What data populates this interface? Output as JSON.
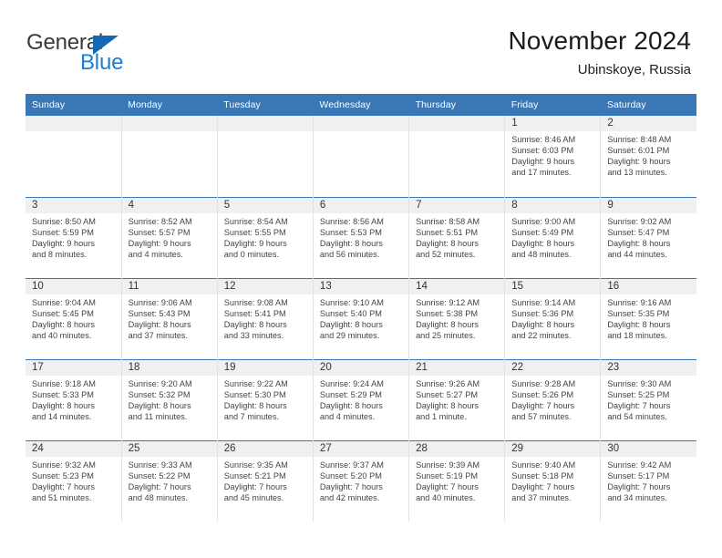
{
  "brand": {
    "name_part1": "General",
    "name_part2": "Blue"
  },
  "header": {
    "title": "November 2024",
    "location": "Ubinskoye, Russia"
  },
  "colors": {
    "header_blue": "#3a78b5",
    "logo_blue": "#1b7fd4",
    "daynum_band": "#f0f0f0",
    "cell_border": "#e2e2e2"
  },
  "weekday_headers": [
    "Sunday",
    "Monday",
    "Tuesday",
    "Wednesday",
    "Thursday",
    "Friday",
    "Saturday"
  ],
  "weeks": [
    [
      {
        "day": "",
        "info": ""
      },
      {
        "day": "",
        "info": ""
      },
      {
        "day": "",
        "info": ""
      },
      {
        "day": "",
        "info": ""
      },
      {
        "day": "",
        "info": ""
      },
      {
        "day": "1",
        "info": "Sunrise: 8:46 AM\nSunset: 6:03 PM\nDaylight: 9 hours\nand 17 minutes."
      },
      {
        "day": "2",
        "info": "Sunrise: 8:48 AM\nSunset: 6:01 PM\nDaylight: 9 hours\nand 13 minutes."
      }
    ],
    [
      {
        "day": "3",
        "info": "Sunrise: 8:50 AM\nSunset: 5:59 PM\nDaylight: 9 hours\nand 8 minutes."
      },
      {
        "day": "4",
        "info": "Sunrise: 8:52 AM\nSunset: 5:57 PM\nDaylight: 9 hours\nand 4 minutes."
      },
      {
        "day": "5",
        "info": "Sunrise: 8:54 AM\nSunset: 5:55 PM\nDaylight: 9 hours\nand 0 minutes."
      },
      {
        "day": "6",
        "info": "Sunrise: 8:56 AM\nSunset: 5:53 PM\nDaylight: 8 hours\nand 56 minutes."
      },
      {
        "day": "7",
        "info": "Sunrise: 8:58 AM\nSunset: 5:51 PM\nDaylight: 8 hours\nand 52 minutes."
      },
      {
        "day": "8",
        "info": "Sunrise: 9:00 AM\nSunset: 5:49 PM\nDaylight: 8 hours\nand 48 minutes."
      },
      {
        "day": "9",
        "info": "Sunrise: 9:02 AM\nSunset: 5:47 PM\nDaylight: 8 hours\nand 44 minutes."
      }
    ],
    [
      {
        "day": "10",
        "info": "Sunrise: 9:04 AM\nSunset: 5:45 PM\nDaylight: 8 hours\nand 40 minutes."
      },
      {
        "day": "11",
        "info": "Sunrise: 9:06 AM\nSunset: 5:43 PM\nDaylight: 8 hours\nand 37 minutes."
      },
      {
        "day": "12",
        "info": "Sunrise: 9:08 AM\nSunset: 5:41 PM\nDaylight: 8 hours\nand 33 minutes."
      },
      {
        "day": "13",
        "info": "Sunrise: 9:10 AM\nSunset: 5:40 PM\nDaylight: 8 hours\nand 29 minutes."
      },
      {
        "day": "14",
        "info": "Sunrise: 9:12 AM\nSunset: 5:38 PM\nDaylight: 8 hours\nand 25 minutes."
      },
      {
        "day": "15",
        "info": "Sunrise: 9:14 AM\nSunset: 5:36 PM\nDaylight: 8 hours\nand 22 minutes."
      },
      {
        "day": "16",
        "info": "Sunrise: 9:16 AM\nSunset: 5:35 PM\nDaylight: 8 hours\nand 18 minutes."
      }
    ],
    [
      {
        "day": "17",
        "info": "Sunrise: 9:18 AM\nSunset: 5:33 PM\nDaylight: 8 hours\nand 14 minutes."
      },
      {
        "day": "18",
        "info": "Sunrise: 9:20 AM\nSunset: 5:32 PM\nDaylight: 8 hours\nand 11 minutes."
      },
      {
        "day": "19",
        "info": "Sunrise: 9:22 AM\nSunset: 5:30 PM\nDaylight: 8 hours\nand 7 minutes."
      },
      {
        "day": "20",
        "info": "Sunrise: 9:24 AM\nSunset: 5:29 PM\nDaylight: 8 hours\nand 4 minutes."
      },
      {
        "day": "21",
        "info": "Sunrise: 9:26 AM\nSunset: 5:27 PM\nDaylight: 8 hours\nand 1 minute."
      },
      {
        "day": "22",
        "info": "Sunrise: 9:28 AM\nSunset: 5:26 PM\nDaylight: 7 hours\nand 57 minutes."
      },
      {
        "day": "23",
        "info": "Sunrise: 9:30 AM\nSunset: 5:25 PM\nDaylight: 7 hours\nand 54 minutes."
      }
    ],
    [
      {
        "day": "24",
        "info": "Sunrise: 9:32 AM\nSunset: 5:23 PM\nDaylight: 7 hours\nand 51 minutes."
      },
      {
        "day": "25",
        "info": "Sunrise: 9:33 AM\nSunset: 5:22 PM\nDaylight: 7 hours\nand 48 minutes."
      },
      {
        "day": "26",
        "info": "Sunrise: 9:35 AM\nSunset: 5:21 PM\nDaylight: 7 hours\nand 45 minutes."
      },
      {
        "day": "27",
        "info": "Sunrise: 9:37 AM\nSunset: 5:20 PM\nDaylight: 7 hours\nand 42 minutes."
      },
      {
        "day": "28",
        "info": "Sunrise: 9:39 AM\nSunset: 5:19 PM\nDaylight: 7 hours\nand 40 minutes."
      },
      {
        "day": "29",
        "info": "Sunrise: 9:40 AM\nSunset: 5:18 PM\nDaylight: 7 hours\nand 37 minutes."
      },
      {
        "day": "30",
        "info": "Sunrise: 9:42 AM\nSunset: 5:17 PM\nDaylight: 7 hours\nand 34 minutes."
      }
    ]
  ]
}
